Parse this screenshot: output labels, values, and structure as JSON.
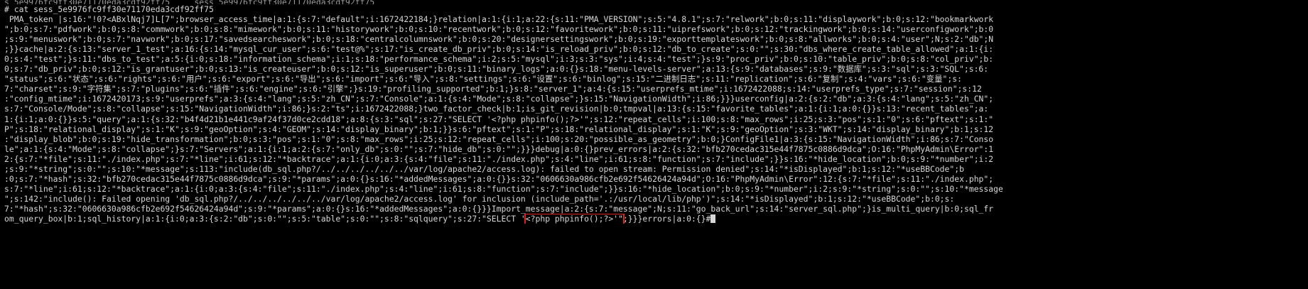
{
  "terminal": {
    "top_partial_line": "s_5e9976fc9ff30e71170eda3cdf92ff75     sess_5e9976fc9ff30e71170eda3cdf92ff75",
    "command_line": "# cat sess_5e9976fc9ff30e71170eda3cdf92ff75",
    "output_lines": [
      " PMA_token |s:16:\"!0?<ABxlNqj7]L[7\";browser_access_time|a:1:{s:7:\"default\";i:1672422184;}relation|a:1:{i:1;a:22:{s:11:\"PMA_VERSION\";s:5:\"4.8.1\";s:7:\"relwork\";b:0;s:11:\"displaywork\";b:0;s:12:\"bookmarkwork",
      "\";b:0;s:7:\"pdfwork\";b:0;s:8:\"commwork\";b:0;s:8:\"mimework\";b:0;s:11:\"historywork\";b:0;s:10:\"recentwork\";b:0;s:12:\"favoritework\";b:0;s:11:\"uiprefswork\";b:0;s:12:\"trackingwork\";b:0;s:14:\"userconfigwork\";b:0",
      ";s:9:\"menuswork\";b:0;s:7:\"navwork\";b:0;s:17:\"savedsearcheswork\";b:0;s:18:\"centralcolumnswork\";b:0;s:20:\"designersettingswork\";b:0;s:19:\"exporttemplateswork\";b:0;s:8:\"allworks\";b:0;s:4:\"user\";N;s:2:\"db\";N",
      ";}}cache|a:2:{s:13:\"server_1_test\";a:16:{s:14:\"mysql_cur_user\";s:6:\"test@%\";s:17:\"is_create_db_priv\";b:0;s:14:\"is_reload_priv\";b:0;s:12:\"db_to_create\";s:0:\"\";s:30:\"dbs_where_create_table_allowed\";a:1:{i:",
      "0;s:4:\"test\";}s:11:\"dbs_to_test\";a:5:{i:0;s:18:\"information_schema\";i:1;s:18:\"performance_schema\";i:2;s:5:\"mysql\";i:3;s:3:\"sys\";i:4;s:4:\"test\";}s:9:\"proc_priv\";b:0;s:10:\"table_priv\";b:0;s:8:\"col_priv\";b:",
      "0;s:7:\"db_priv\";b:0;s:12:\"is_grantuser\";b:0;s:13:\"is_createuser\";b:0;s:12:\"is_superuser\";b:0;s:11:\"binary_logs\";a:0:{}s:18:\"menu-levels-server\";a:13:{s:9:\"databases\";s:9:\"数据库\";s:3:\"sql\";s:3:\"SQL\";s:6:",
      "\"status\";s:6:\"状态\";s:6:\"rights\";s:6:\"用户\";s:6:\"export\";s:6:\"导出\";s:6:\"import\";s:6:\"导入\";s:8:\"settings\";s:6:\"设置\";s:6:\"binlog\";s:15:\"二进制日志\";s:11:\"replication\";s:6:\"复制\";s:4:\"vars\";s:6:\"变量\";s:",
      "7:\"charset\";s:9:\"字符集\";s:7:\"plugins\";s:6:\"插件\";s:6:\"engine\";s:6:\"引擎\";}s:19:\"profiling_supported\";b:1;}s:8:\"server_1\";a:4:{s:15:\"userprefs_mtime\";i:1672422088;s:14:\"userprefs_type\";s:7:\"session\";s:12",
      ":\"config_mtime\";i:1672420173;s:9:\"userprefs\";a:3:{s:4:\"lang\";s:5:\"zh_CN\";s:7:\"Console\";a:1:{s:4:\"Mode\";s:8:\"collapse\";}s:15:\"NavigationWidth\";i:86;}}}userconfig|a:2:{s:2:\"db\";a:3:{s:4:\"lang\";s:5:\"zh_CN\";",
      "s:7:\"Console/Mode\";s:8:\"collapse\";s:15:\"NavigationWidth\";i:86;}s:2:\"ts\";i:1672422088;}two_factor_check|b:1;is_git_revision|b:0;tmpval|a:13:{s:15:\"favorite_tables\";a:1:{i:1;a:0:{}}s:13:\"recent_tables\";a:",
      "1:{i:1;a:0:{}}s:5:\"query\";a:1:{s:32:\"b4f4d21b1e441c9af24f37d0ce2cdd18\";a:8:{s:3:\"sql\";s:27:\"SELECT '<?php phpinfo();?>'\";s:12:\"repeat_cells\";i:100;s:8:\"max_rows\";i:25;s:3:\"pos\";s:1:\"0\";s:6:\"pftext\";s:1:\"",
      "P\";s:18:\"relational_display\";s:1:\"K\";s:9:\"geoOption\";s:4:\"GEOM\";s:14:\"display_binary\";b:1;}}s:6:\"pftext\";s:1:\"P\";s:18:\"relational_display\";s:1:\"K\";s:9:\"geoOption\";s:3:\"WKT\";s:14:\"display_binary\";b:1;s:12",
      ":\"display_blob\";b:0;s:19:\"hide_transformation\";b:0;s:3:\"pos\";s:1:\"0\";s:8:\"max_rows\";i:25;s:12:\"repeat_cells\";i:100;s:20:\"possible_as_geometry\";b:0;}ConfigFile1|a:3:{s:15:\"NavigationWidth\";i:86;s:7:\"Conso",
      "le\";a:1:{s:4:\"Mode\";s:8:\"collapse\";}s:7:\"Servers\";a:1:{i:1;a:2:{s:7:\"only_db\";s:0:\"\";s:7:\"hide_db\";s:0:\"\";}}}debug|a:0:{}prev_errors|a:2:{s:32:\"bfb270cedac315e44f7875c0886d9dca\";O:16:\"PhpMyAdmin\\Error\":1",
      "2:{s:7:\"*file\";s:11:\"./index.php\";s:7:\"*line\";i:61;s:12:\"*backtrace\";a:1:{i:0;a:3:{s:4:\"file\";s:11:\"./index.php\";s:4:\"line\";i:61;s:8:\"function\";s:7:\"include\";}}s:16:\"*hide_location\";b:0;s:9:\"*number\";i:2",
      ";s:9:\"*string\";s:0:\"\";s:10:\"*message\";s:113:\"include(db_sql.php?/../../../../../../var/log/apache2/access.log): failed to open stream: Permission denied\";s:14:\"*isDisplayed\";b:1;s:12:\"*useBBCode\";b",
      ":0;s:7:\"*hash\";s:32:\"bfb270cedac315e44f7875c0886d9dca\";s:9:\"*params\";a:0:{}s:16:\"*addedMessages\";a:0:{}}s:32:\"0606630a986cfb2e692f54626424a94d\";O:16:\"PhpMyAdmin\\Error\":12:{s:7:\"*file\";s:11:\"./index.php\";",
      "s:7:\"*line\";i:61;s:12:\"*backtrace\";a:1:{i:0;a:3:{s:4:\"file\";s:11:\"./index.php\";s:4:\"line\";i:61;s:8:\"function\";s:7:\"include\";}}s:16:\"*hide_location\";b:0;s:9:\"*number\";i:2;s:9:\"*string\";s:0:\"\";s:10:\"*message",
      "\";s:142:\"include(): Failed opening 'db_sql.php?/../../../../../../var/log/apache2/access.log' for inclusion (include_path='.:/usr/local/lib/php')\";s:14:\"*isDisplayed\";b:1;s:12:\"*useBBCode\";b:0;s:",
      "7:\"*hash\";s:32:\"0606630a986cfb2e692f54626424a94d\";s:9:\"*params\";a:0:{}s:16:\"*addedMessages\";a:0:{}}}Import_message|a:2:{s:7:\"message\";N;s:11:\"go_back_url\";s:14:\"server_sql.php\";}is_multi_query|b:0;sql_fr",
      "om_query_box|b:1;sql_history|a:1:{i:0;a:3:{s:2:\"db\";s:0:\"\";s:5:\"table\";s:0:\"\";s:8:\"sqlquery\";s:27:\"SELECT '"
    ],
    "highlight": "<?php phpinfo();?>'\"",
    "last_line_tail": ";}}}errors|a:0:{}#"
  }
}
